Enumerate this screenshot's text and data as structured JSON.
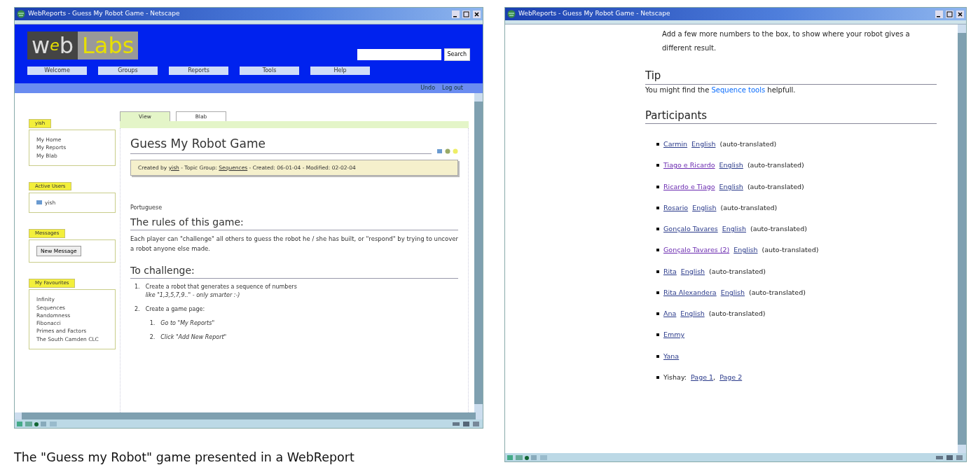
{
  "left_window": {
    "title": "WebReports - Guess My Robot Game - Netscape",
    "logo": [
      {
        "text": "w",
        "kind": "plain"
      },
      {
        "text": "e",
        "kind": "accent"
      },
      {
        "text": "b",
        "kind": "plain"
      },
      {
        "text": "Labs",
        "kind": "block"
      }
    ],
    "search": {
      "button": "Search"
    },
    "nav": [
      "Welcome",
      "Groups",
      "Reports",
      "Tools",
      "Help"
    ],
    "util_links": [
      "Undo",
      "Log out"
    ],
    "sidebar": [
      {
        "title": "yish",
        "kind": "links",
        "items": [
          "My Home",
          "My Reports",
          "My Blab"
        ]
      },
      {
        "title": "Active Users",
        "kind": "users",
        "items": [
          "yish"
        ]
      },
      {
        "title": "Messages",
        "kind": "buttons",
        "items": [
          "New Message"
        ]
      },
      {
        "title": "My Favourites",
        "kind": "links",
        "items": [
          "Infinity",
          "Sequences",
          "Randomness",
          "Fibonacci",
          "Primes and Factors",
          "The South Camden CLC"
        ]
      }
    ],
    "tabs": [
      {
        "label": "View",
        "selected": true
      },
      {
        "label": "Blab",
        "selected": false
      }
    ],
    "page_title": "Guess My Robot Game",
    "meta": [
      {
        "text": "Created by ",
        "kind": "text"
      },
      {
        "text": "yish",
        "kind": "link"
      },
      {
        "text": " - Topic Group: ",
        "kind": "text"
      },
      {
        "text": "Sequences",
        "kind": "link"
      },
      {
        "text": " - Created: 06-01-04 - Modified: 02-02-04",
        "kind": "text"
      }
    ],
    "language": "Portuguese",
    "rules": {
      "heading": "The rules of this game:",
      "paragraph": "Each player can \"challenge\" all others to guess the robot he / she has built, or \"respond\" by trying to uncover a robot anyone else made."
    },
    "challenge": {
      "heading": "To challenge:",
      "steps": [
        {
          "number": "1.",
          "text": "Create a robot that generates a sequence of numbers",
          "note": "like \"1,3,5,7,9..\" - only smarter :-)"
        },
        {
          "number": "2.",
          "text": "Create a game page:",
          "substeps": [
            {
              "number": "1.",
              "text": "Go to \"My Reports\""
            },
            {
              "number": "2.",
              "text": "Click \"Add New Report\""
            }
          ]
        }
      ]
    }
  },
  "caption": "The \"Guess my Robot\" game presented in a WebReport",
  "right_window": {
    "title": "WebReports - Guess My Robot Game - Netscape",
    "continued": "Add a few more numbers to the box, to show where your robot gives a different result.",
    "tip": {
      "heading": "Tip",
      "text": [
        {
          "text": "You might find the ",
          "kind": "text"
        },
        {
          "text": "Sequence tools",
          "kind": "link"
        },
        {
          "text": " helpfull.",
          "kind": "text"
        }
      ]
    },
    "participants": {
      "heading": "Participants",
      "items": [
        {
          "kind": "translated",
          "name": "Carmin",
          "visited": false,
          "link": "English",
          "note": "(auto-translated)"
        },
        {
          "kind": "translated",
          "name": "Tiago e Ricardo",
          "visited": true,
          "link": "English",
          "note": "(auto-translated)"
        },
        {
          "kind": "translated",
          "name": "Ricardo e Tiago",
          "visited": true,
          "link": "English",
          "note": "(auto-translated)"
        },
        {
          "kind": "translated",
          "name": "Rosario",
          "visited": false,
          "link": "English",
          "note": "(auto-translated)"
        },
        {
          "kind": "translated",
          "name": "Gonçalo Tavares",
          "visited": false,
          "link": "English",
          "note": "(auto-translated)"
        },
        {
          "kind": "translated",
          "name": "Gonçalo Tavares (2)",
          "visited": true,
          "link": "English",
          "note": "(auto-translated)"
        },
        {
          "kind": "translated",
          "name": "Rita",
          "visited": false,
          "link": "English",
          "note": "(auto-translated)"
        },
        {
          "kind": "translated",
          "name": "Rita Alexandera",
          "visited": false,
          "link": "English",
          "note": "(auto-translated)"
        },
        {
          "kind": "translated",
          "name": "Ana",
          "visited": false,
          "link": "English",
          "note": "(auto-translated)"
        },
        {
          "kind": "plain",
          "name": "Emmy",
          "visited": false
        },
        {
          "kind": "plain",
          "name": "Yana",
          "visited": false
        },
        {
          "kind": "pages",
          "name": "Yishay:",
          "pages": [
            "Page 1",
            "Page 2"
          ],
          "separator": ","
        }
      ]
    }
  }
}
